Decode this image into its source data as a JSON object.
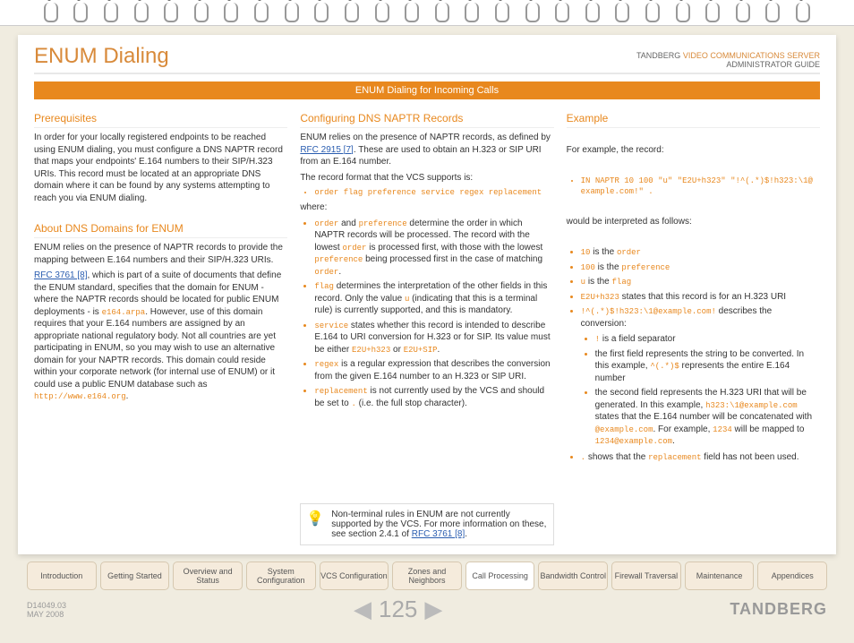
{
  "header": {
    "title": "ENUM Dialing",
    "brand": "TANDBERG",
    "product": "VIDEO COMMUNICATIONS SERVER",
    "guide": "ADMINISTRATOR GUIDE"
  },
  "bar": "ENUM Dialing for Incoming Calls",
  "col1": {
    "h1": "Prerequisites",
    "p1": "In order for your locally registered endpoints to be reached using ENUM dialing, you must configure a DNS NAPTR record that maps your endpoints' E.164 numbers to their SIP/H.323 URIs. This record must be located at an appropriate DNS domain where it can be found by any systems attempting to reach you via ENUM dialing.",
    "h2": "About DNS Domains for ENUM",
    "p2": "ENUM relies on the presence of NAPTR records to provide the mapping between E.164 numbers and their SIP/H.323 URIs.",
    "p3a": "RFC 3761 [8]",
    "p3b": ", which is part of a suite of documents that define the ENUM standard, specifies that the domain for ENUM - where the NAPTR records should be located for public ENUM deployments - is ",
    "p3c": "e164.arpa",
    "p3d": ". However, use of this domain requires that your E.164 numbers are assigned by an appropriate national regulatory body. Not all countries are yet participating in ENUM, so you may wish to use an alternative domain for your NAPTR records. This domain could reside within your corporate network (for internal use of ENUM) or it could use a public ENUM database such as ",
    "p3e": "http://www.e164.org",
    "p3f": "."
  },
  "col2": {
    "h1": "Configuring DNS NAPTR Records",
    "p1a": "ENUM relies on the presence of NAPTR records, as defined by ",
    "p1b": "RFC 2915 [7]",
    "p1c": ". These are used to obtain an H.323 or SIP URI from an E.164 number.",
    "p2": "The record format that the VCS supports is:",
    "fmt": "order flag preference service regex replacement",
    "p3": "where:",
    "b1a": "order",
    "b1b": " and ",
    "b1c": "preference",
    "b1d": " determine the order in which NAPTR records will be processed.  The record with the lowest ",
    "b1e": "order",
    "b1f": " is processed first, with those with the lowest ",
    "b1g": "preference",
    "b1h": " being processed first in the case of matching ",
    "b1i": "order",
    "b1j": ".",
    "b2a": "flag",
    "b2b": " determines the interpretation of the other fields in this record. Only the value ",
    "b2c": "u",
    "b2d": " (indicating that this is a terminal rule) is currently supported, and this is mandatory.",
    "b3a": "service",
    "b3b": " states whether this record is intended to describe E.164 to URI conversion for H.323 or for SIP. Its value must be either ",
    "b3c": "E2U+h323",
    "b3d": " or ",
    "b3e": "E2U+SIP",
    "b3f": ".",
    "b4a": "regex",
    "b4b": " is a regular expression that describes the conversion from the given E.164 number to an H.323 or SIP URI.",
    "b5a": "replacement",
    "b5b": " is not currently used by the VCS and should be set to ",
    "b5c": ".",
    "b5d": " (i.e. the full stop character).",
    "tip1": "Non-terminal rules in ENUM are not currently supported by the VCS.  For more information on these, see section 2.4.1 of ",
    "tip2": "RFC 3761 [8]",
    "tip3": "."
  },
  "col3": {
    "h1": "Example",
    "p1": "For example, the record:",
    "rec": "IN NAPTR 10 100 \"u\" \"E2U+h323\" \"!^(.*)$!h323:\\1@ example.com!\" .",
    "p2": "would be interpreted as follows:",
    "b1a": "10",
    "b1b": " is the ",
    "b1c": "order",
    "b2a": "100",
    "b2b": " is the ",
    "b2c": "preference",
    "b3a": "u",
    "b3b": " is the ",
    "b3c": "flag",
    "b4a": "E2U+h323",
    "b4b": " states that this record is for an H.323 URI",
    "b5a": "!^(.*)$!h323:\\1@example.com!",
    "b5b": " describes the conversion:",
    "s1a": "!",
    "s1b": " is a field separator",
    "s2a": "the first field represents the string to be converted.  In this example, ",
    "s2b": "^(.*)$",
    "s2c": " represents the entire E.164 number",
    "s3a": "the second field represents the H.323 URI that will be generated. In this example, ",
    "s3b": "h323:\\1@example.com",
    "s3c": " states that the E.164 number will be concatenated with ",
    "s3d": "@example.com",
    "s3e": ".  For example, ",
    "s3f": "1234",
    "s3g": " will be mapped to ",
    "s3h": "1234@example.com",
    "s3i": ".",
    "b6a": ".",
    "b6b": " shows that the ",
    "b6c": "replacement",
    "b6d": " field has not been used."
  },
  "tabs": [
    "Introduction",
    "Getting Started",
    "Overview and Status",
    "System Configuration",
    "VCS Configuration",
    "Zones and Neighbors",
    "Call Processing",
    "Bandwidth Control",
    "Firewall Traversal",
    "Maintenance",
    "Appendices"
  ],
  "footer": {
    "doc": "D14049.03",
    "date": "MAY 2008",
    "page": "125",
    "brand": "TANDBERG"
  }
}
